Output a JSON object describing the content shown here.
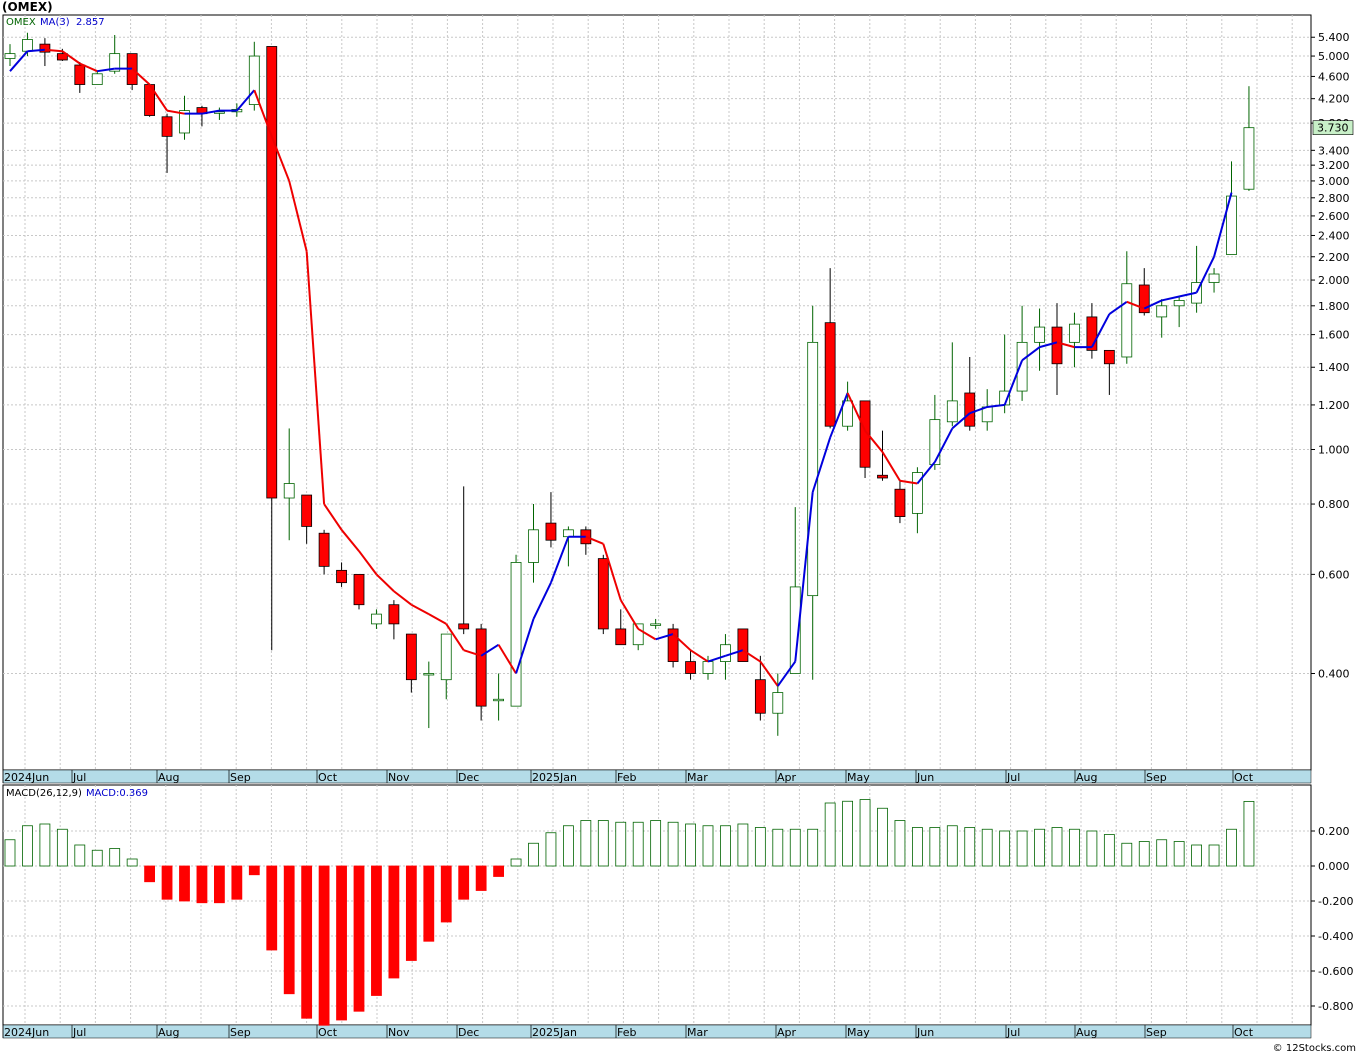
{
  "title": "(OMEX)",
  "credit": "© 12Stocks.com",
  "colors": {
    "up": "#006400",
    "down": "#ff0000",
    "ma_up": "#0000dd",
    "ma_down": "#ee0000",
    "grid": "#c8c8c8",
    "axis_band": "#b4dce8",
    "last_price_bg": "#c8f0c8"
  },
  "price_panel": {
    "ticker": "OMEX",
    "ma_label": "MA(3)",
    "ma_value": "2.857",
    "last_price": "3.730",
    "y_scale": "log",
    "y_ticks": [
      "5.400",
      "5.000",
      "4.600",
      "4.200",
      "3.800",
      "3.400",
      "3.200",
      "3.000",
      "2.800",
      "2.600",
      "2.400",
      "2.200",
      "2.000",
      "1.800",
      "1.600",
      "1.400",
      "1.200",
      "1.000",
      "0.800",
      "0.600",
      "0.400"
    ]
  },
  "macd_panel": {
    "label": "MACD(26,12,9)",
    "value_label": "MACD:0.369",
    "y_ticks": [
      "0.200",
      "0.000",
      "-0.200",
      "-0.400",
      "-0.600",
      "-0.800"
    ]
  },
  "months": [
    "2024Jun",
    "Jul",
    "Aug",
    "Sep",
    "Oct",
    "Nov",
    "Dec",
    "2025Jan",
    "Feb",
    "Mar",
    "Apr",
    "May",
    "Jun",
    "Jul",
    "Aug",
    "Sep",
    "Oct"
  ],
  "chart_data": {
    "type": "candlestick",
    "period": "weekly",
    "series_candles": [
      {
        "o": 4.95,
        "h": 5.25,
        "l": 4.8,
        "c": 5.05
      },
      {
        "o": 5.1,
        "h": 5.5,
        "l": 5.0,
        "c": 5.35
      },
      {
        "o": 5.25,
        "h": 5.38,
        "l": 4.8,
        "c": 5.08
      },
      {
        "o": 5.05,
        "h": 5.15,
        "l": 4.9,
        "c": 4.92
      },
      {
        "o": 4.82,
        "h": 4.88,
        "l": 4.3,
        "c": 4.45
      },
      {
        "o": 4.45,
        "h": 4.7,
        "l": 4.45,
        "c": 4.65
      },
      {
        "o": 4.7,
        "h": 5.45,
        "l": 4.65,
        "c": 5.05
      },
      {
        "o": 5.05,
        "h": 5.05,
        "l": 4.35,
        "c": 4.45
      },
      {
        "o": 4.45,
        "h": 4.45,
        "l": 3.9,
        "c": 3.92
      },
      {
        "o": 3.9,
        "h": 3.95,
        "l": 3.1,
        "c": 3.6
      },
      {
        "o": 3.65,
        "h": 4.25,
        "l": 3.55,
        "c": 4.0
      },
      {
        "o": 4.05,
        "h": 4.08,
        "l": 3.75,
        "c": 3.95
      },
      {
        "o": 3.98,
        "h": 4.05,
        "l": 3.85,
        "c": 3.98
      },
      {
        "o": 3.98,
        "h": 4.12,
        "l": 3.9,
        "c": 4.02
      },
      {
        "o": 4.1,
        "h": 5.3,
        "l": 4.0,
        "c": 5.0
      },
      {
        "o": 5.2,
        "h": 5.2,
        "l": 0.44,
        "c": 0.82
      },
      {
        "o": 0.82,
        "h": 1.09,
        "l": 0.69,
        "c": 0.87
      },
      {
        "o": 0.83,
        "h": 0.83,
        "l": 0.68,
        "c": 0.73
      },
      {
        "o": 0.71,
        "h": 0.72,
        "l": 0.6,
        "c": 0.62
      },
      {
        "o": 0.61,
        "h": 0.63,
        "l": 0.57,
        "c": 0.58
      },
      {
        "o": 0.6,
        "h": 0.6,
        "l": 0.52,
        "c": 0.53
      },
      {
        "o": 0.49,
        "h": 0.52,
        "l": 0.48,
        "c": 0.51
      },
      {
        "o": 0.53,
        "h": 0.54,
        "l": 0.46,
        "c": 0.49
      },
      {
        "o": 0.47,
        "h": 0.47,
        "l": 0.37,
        "c": 0.39
      },
      {
        "o": 0.4,
        "h": 0.42,
        "l": 0.32,
        "c": 0.4
      },
      {
        "o": 0.39,
        "h": 0.47,
        "l": 0.36,
        "c": 0.47
      },
      {
        "o": 0.49,
        "h": 0.86,
        "l": 0.47,
        "c": 0.48
      },
      {
        "o": 0.48,
        "h": 0.49,
        "l": 0.33,
        "c": 0.35
      },
      {
        "o": 0.36,
        "h": 0.4,
        "l": 0.33,
        "c": 0.36
      },
      {
        "o": 0.35,
        "h": 0.65,
        "l": 0.35,
        "c": 0.63
      },
      {
        "o": 0.63,
        "h": 0.8,
        "l": 0.58,
        "c": 0.72
      },
      {
        "o": 0.74,
        "h": 0.84,
        "l": 0.67,
        "c": 0.69
      },
      {
        "o": 0.7,
        "h": 0.73,
        "l": 0.62,
        "c": 0.72
      },
      {
        "o": 0.72,
        "h": 0.73,
        "l": 0.65,
        "c": 0.68
      },
      {
        "o": 0.64,
        "h": 0.65,
        "l": 0.47,
        "c": 0.48
      },
      {
        "o": 0.48,
        "h": 0.52,
        "l": 0.45,
        "c": 0.45
      },
      {
        "o": 0.45,
        "h": 0.49,
        "l": 0.44,
        "c": 0.49
      },
      {
        "o": 0.49,
        "h": 0.5,
        "l": 0.48,
        "c": 0.49
      },
      {
        "o": 0.48,
        "h": 0.49,
        "l": 0.41,
        "c": 0.42
      },
      {
        "o": 0.42,
        "h": 0.44,
        "l": 0.39,
        "c": 0.4
      },
      {
        "o": 0.4,
        "h": 0.43,
        "l": 0.39,
        "c": 0.42
      },
      {
        "o": 0.42,
        "h": 0.47,
        "l": 0.39,
        "c": 0.45
      },
      {
        "o": 0.48,
        "h": 0.48,
        "l": 0.42,
        "c": 0.42
      },
      {
        "o": 0.39,
        "h": 0.43,
        "l": 0.33,
        "c": 0.34
      },
      {
        "o": 0.34,
        "h": 0.4,
        "l": 0.31,
        "c": 0.37
      },
      {
        "o": 0.4,
        "h": 0.79,
        "l": 0.4,
        "c": 0.57
      },
      {
        "o": 0.55,
        "h": 1.8,
        "l": 0.39,
        "c": 1.55
      },
      {
        "o": 1.68,
        "h": 2.1,
        "l": 1.09,
        "c": 1.1
      },
      {
        "o": 1.1,
        "h": 1.32,
        "l": 1.08,
        "c": 1.22
      },
      {
        "o": 1.22,
        "h": 1.22,
        "l": 0.89,
        "c": 0.93
      },
      {
        "o": 0.9,
        "h": 1.08,
        "l": 0.88,
        "c": 0.89
      },
      {
        "o": 0.85,
        "h": 0.88,
        "l": 0.74,
        "c": 0.76
      },
      {
        "o": 0.77,
        "h": 0.93,
        "l": 0.71,
        "c": 0.91
      },
      {
        "o": 0.94,
        "h": 1.25,
        "l": 0.92,
        "c": 1.13
      },
      {
        "o": 1.12,
        "h": 1.55,
        "l": 1.1,
        "c": 1.22
      },
      {
        "o": 1.26,
        "h": 1.46,
        "l": 1.08,
        "c": 1.1
      },
      {
        "o": 1.12,
        "h": 1.28,
        "l": 1.08,
        "c": 1.19
      },
      {
        "o": 1.2,
        "h": 1.6,
        "l": 1.16,
        "c": 1.27
      },
      {
        "o": 1.27,
        "h": 1.8,
        "l": 1.22,
        "c": 1.55
      },
      {
        "o": 1.55,
        "h": 1.78,
        "l": 1.38,
        "c": 1.65
      },
      {
        "o": 1.65,
        "h": 1.82,
        "l": 1.25,
        "c": 1.42
      },
      {
        "o": 1.55,
        "h": 1.75,
        "l": 1.4,
        "c": 1.67
      },
      {
        "o": 1.72,
        "h": 1.82,
        "l": 1.45,
        "c": 1.5
      },
      {
        "o": 1.5,
        "h": 1.5,
        "l": 1.25,
        "c": 1.42
      },
      {
        "o": 1.46,
        "h": 2.25,
        "l": 1.42,
        "c": 1.97
      },
      {
        "o": 1.96,
        "h": 2.1,
        "l": 1.73,
        "c": 1.75
      },
      {
        "o": 1.72,
        "h": 1.85,
        "l": 1.58,
        "c": 1.8
      },
      {
        "o": 1.8,
        "h": 1.87,
        "l": 1.65,
        "c": 1.84
      },
      {
        "o": 1.82,
        "h": 2.3,
        "l": 1.75,
        "c": 1.98
      },
      {
        "o": 1.98,
        "h": 2.1,
        "l": 1.9,
        "c": 2.05
      },
      {
        "o": 2.22,
        "h": 3.25,
        "l": 2.22,
        "c": 2.82
      },
      {
        "o": 2.9,
        "h": 4.42,
        "l": 2.88,
        "c": 3.73
      }
    ],
    "series_ma3": [
      4.7,
      5.1,
      5.13,
      5.1,
      4.85,
      4.7,
      4.75,
      4.75,
      4.45,
      4.0,
      3.95,
      3.95,
      4.0,
      4.0,
      4.35,
      3.6,
      3.0,
      2.25,
      0.8,
      0.72,
      0.66,
      0.6,
      0.56,
      0.53,
      0.51,
      0.49,
      0.44,
      0.43,
      0.45,
      0.4,
      0.5,
      0.58,
      0.7,
      0.7,
      0.68,
      0.54,
      0.48,
      0.46,
      0.47,
      0.44,
      0.42,
      0.43,
      0.44,
      0.42,
      0.38,
      0.42,
      0.84,
      1.05,
      1.26,
      1.08,
      0.99,
      0.88,
      0.87,
      0.95,
      1.09,
      1.16,
      1.19,
      1.2,
      1.44,
      1.52,
      1.55,
      1.52,
      1.52,
      1.74,
      1.83,
      1.78,
      1.84,
      1.87,
      1.9,
      2.2,
      2.86
    ],
    "macd_values": [
      0.15,
      0.23,
      0.24,
      0.21,
      0.12,
      0.09,
      0.1,
      0.04,
      -0.09,
      -0.19,
      -0.2,
      -0.21,
      -0.21,
      -0.19,
      -0.05,
      -0.48,
      -0.73,
      -0.87,
      -0.91,
      -0.88,
      -0.83,
      -0.74,
      -0.64,
      -0.54,
      -0.43,
      -0.32,
      -0.19,
      -0.14,
      -0.06,
      0.04,
      0.13,
      0.19,
      0.23,
      0.26,
      0.26,
      0.25,
      0.25,
      0.26,
      0.25,
      0.24,
      0.23,
      0.23,
      0.24,
      0.22,
      0.21,
      0.21,
      0.21,
      0.36,
      0.37,
      0.38,
      0.33,
      0.26,
      0.22,
      0.22,
      0.23,
      0.22,
      0.21,
      0.2,
      0.2,
      0.21,
      0.22,
      0.21,
      0.2,
      0.18,
      0.13,
      0.14,
      0.15,
      0.14,
      0.12,
      0.12,
      0.21,
      0.369
    ]
  }
}
